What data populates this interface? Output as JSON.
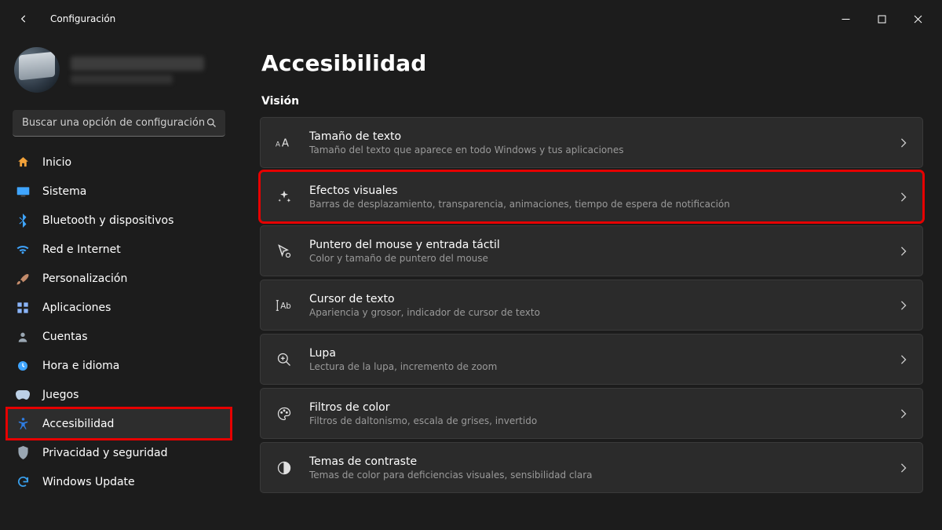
{
  "window": {
    "title": "Configuración",
    "controls": {
      "minimize": "—",
      "maximize": "□",
      "close": "✕"
    }
  },
  "search": {
    "placeholder": "Buscar una opción de configuración"
  },
  "sidebar": {
    "items": [
      {
        "label": "Inicio"
      },
      {
        "label": "Sistema"
      },
      {
        "label": "Bluetooth y dispositivos"
      },
      {
        "label": "Red e Internet"
      },
      {
        "label": "Personalización"
      },
      {
        "label": "Aplicaciones"
      },
      {
        "label": "Cuentas"
      },
      {
        "label": "Hora e idioma"
      },
      {
        "label": "Juegos"
      },
      {
        "label": "Accesibilidad"
      },
      {
        "label": "Privacidad y seguridad"
      },
      {
        "label": "Windows Update"
      }
    ]
  },
  "page": {
    "title": "Accesibilidad",
    "section": "Visión",
    "cards": [
      {
        "title": "Tamaño de texto",
        "subtitle": "Tamaño del texto que aparece en todo Windows y tus aplicaciones"
      },
      {
        "title": "Efectos visuales",
        "subtitle": "Barras de desplazamiento, transparencia, animaciones, tiempo de espera de notificación"
      },
      {
        "title": "Puntero del mouse y entrada táctil",
        "subtitle": "Color y tamaño de puntero del mouse"
      },
      {
        "title": "Cursor de texto",
        "subtitle": "Apariencia y grosor, indicador de cursor de texto"
      },
      {
        "title": "Lupa",
        "subtitle": "Lectura de la lupa, incremento de zoom"
      },
      {
        "title": "Filtros de color",
        "subtitle": "Filtros de daltonismo, escala de grises, invertido"
      },
      {
        "title": "Temas de contraste",
        "subtitle": "Temas de color para deficiencias visuales, sensibilidad clara"
      }
    ]
  }
}
